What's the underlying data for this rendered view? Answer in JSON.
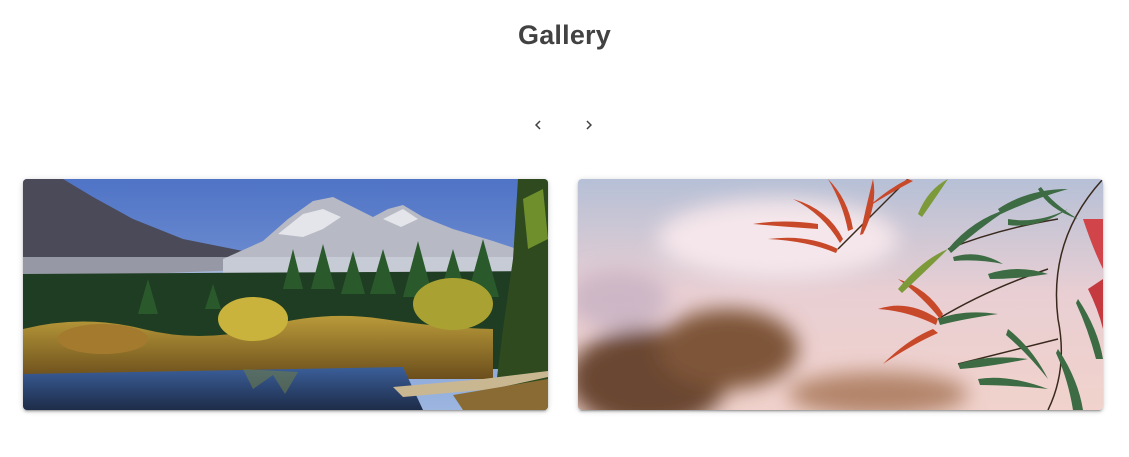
{
  "header": {
    "title": "Gallery"
  },
  "carousel": {
    "prev_icon": "chevron-left-icon",
    "next_icon": "chevron-right-icon",
    "icon_color": "#424242"
  },
  "images": [
    {
      "subject": "mountain-lake-landscape"
    },
    {
      "subject": "red-green-leaves-blurred-sky"
    }
  ]
}
